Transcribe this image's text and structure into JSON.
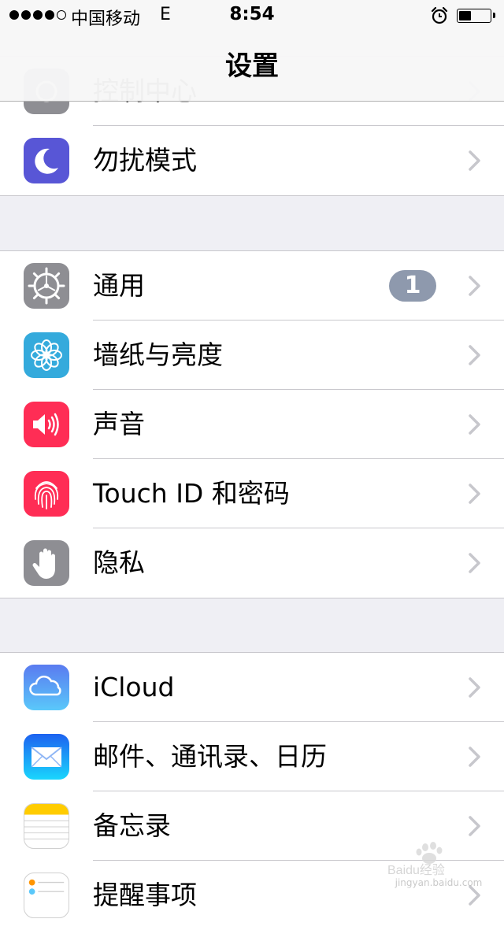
{
  "status_bar": {
    "carrier": "中国移动",
    "network": "E",
    "time": "8:54",
    "battery_level": 0.4
  },
  "nav": {
    "title": "设置"
  },
  "groups": [
    {
      "items": [
        {
          "label": "控制中心",
          "icon": "control-center-icon"
        },
        {
          "label": "勿扰模式",
          "icon": "moon-icon",
          "color": "#5856d6"
        }
      ]
    },
    {
      "items": [
        {
          "label": "通用",
          "icon": "gear-icon",
          "color": "#8e8e93",
          "badge": "1"
        },
        {
          "label": "墙纸与亮度",
          "icon": "flower-icon",
          "color": "#34aadc"
        },
        {
          "label": "声音",
          "icon": "speaker-icon",
          "color": "#ff2d55"
        },
        {
          "label": "Touch ID 和密码",
          "icon": "fingerprint-icon",
          "color": "#ff2d55"
        },
        {
          "label": "隐私",
          "icon": "hand-icon",
          "color": "#8e8e93"
        }
      ]
    },
    {
      "items": [
        {
          "label": "iCloud",
          "icon": "cloud-icon",
          "color": "#5ac8fa"
        },
        {
          "label": "邮件、通讯录、日历",
          "icon": "mail-icon",
          "color": "#1d77ef"
        },
        {
          "label": "备忘录",
          "icon": "notes-icon",
          "color": "#ffcc00"
        },
        {
          "label": "提醒事项",
          "icon": "reminders-icon",
          "color": "#ffffff"
        }
      ]
    }
  ],
  "watermark": {
    "brand": "Baidu经验",
    "url": "jingyan.baidu.com"
  }
}
